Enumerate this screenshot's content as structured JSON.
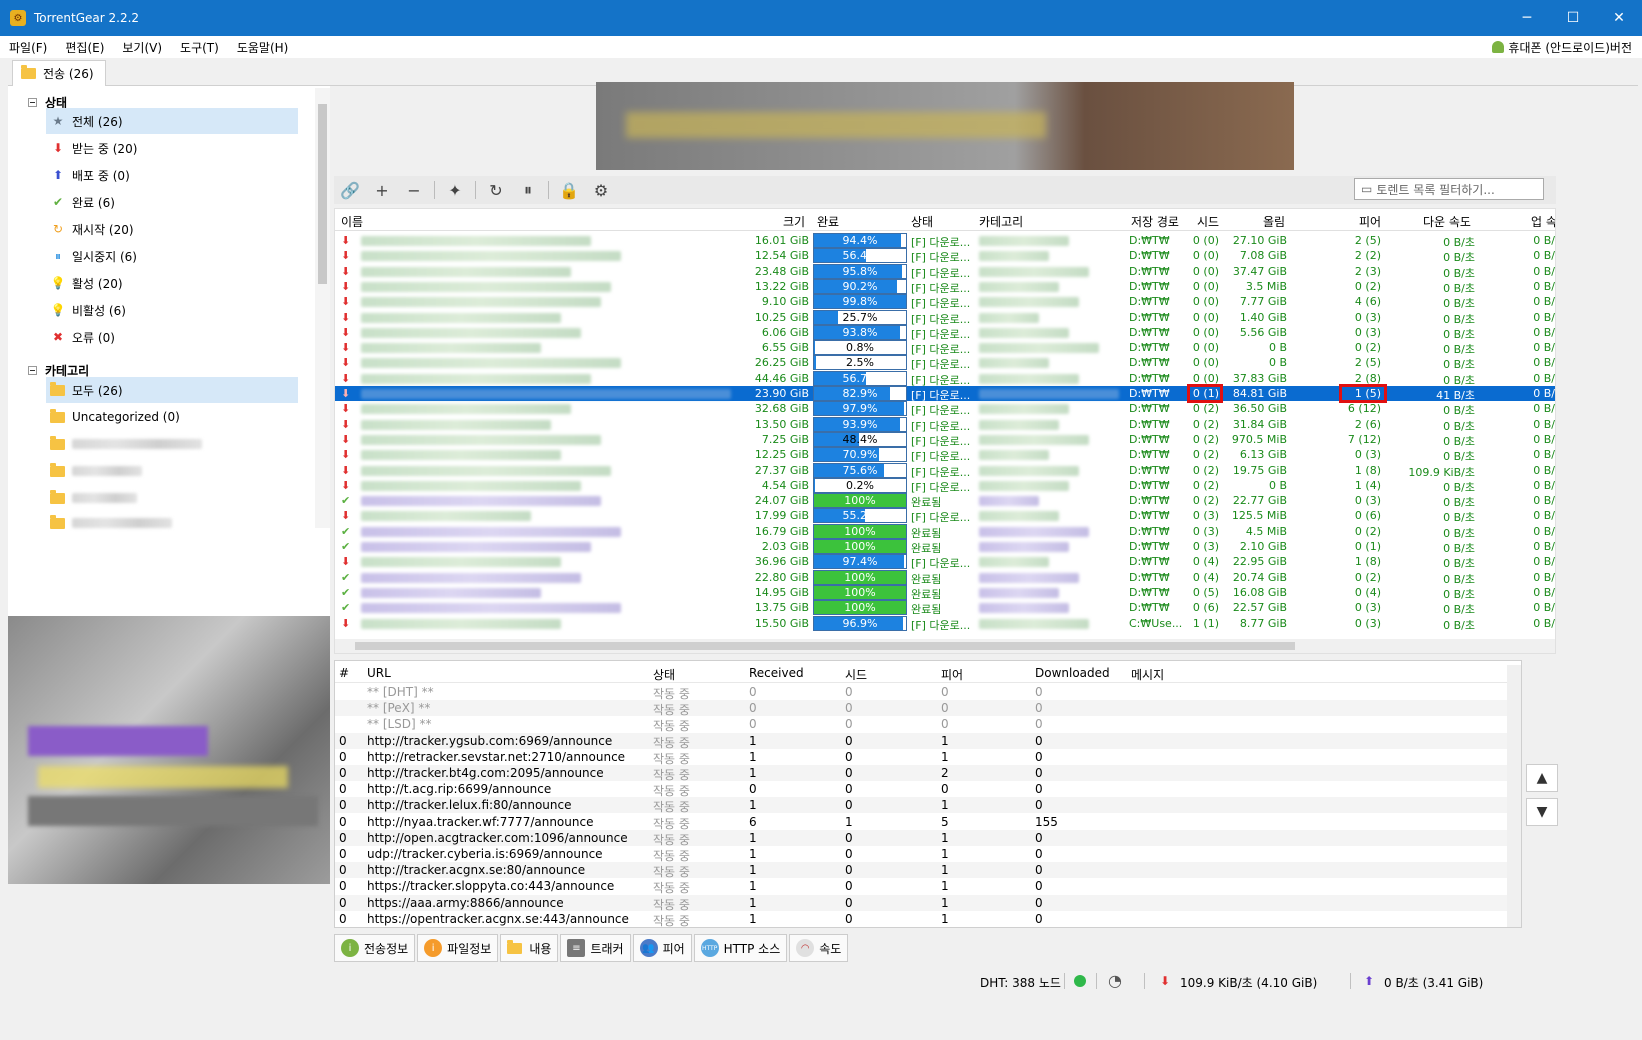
{
  "window": {
    "title": "TorrentGear 2.2.2"
  },
  "menu": {
    "items": [
      "파일(F)",
      "편집(E)",
      "보기(V)",
      "도구(T)",
      "도움말(H)"
    ],
    "mobile": "휴대폰 (안드로이드)버전"
  },
  "tab": {
    "label": "전송 (26)"
  },
  "sidebar": {
    "status_header": "상태",
    "status_items": [
      {
        "label": "전체 (26)",
        "icon": "star-icon"
      },
      {
        "label": "받는 중 (20)",
        "icon": "down-arrow-icon"
      },
      {
        "label": "배포 중 (0)",
        "icon": "up-arrow-icon"
      },
      {
        "label": "완료 (6)",
        "icon": "check-icon"
      },
      {
        "label": "재시작 (20)",
        "icon": "restart-icon"
      },
      {
        "label": "일시중지 (6)",
        "icon": "pause-icon"
      },
      {
        "label": "활성 (20)",
        "icon": "bulb-on-icon"
      },
      {
        "label": "비활성 (6)",
        "icon": "bulb-off-icon"
      },
      {
        "label": "오류 (0)",
        "icon": "error-icon"
      }
    ],
    "category_header": "카테고리",
    "category_items": [
      {
        "label": "모두 (26)"
      },
      {
        "label": "Uncategorized (0)"
      }
    ]
  },
  "toolbar": {
    "filter_placeholder": "토렌트 목록 필터하기..."
  },
  "grid": {
    "headers": {
      "name": "이름",
      "size": "크기",
      "done": "완료",
      "state": "상태",
      "category": "카테고리",
      "path": "저장 경로",
      "seeds": "시드",
      "upload": "올림",
      "peers": "피어",
      "down_speed": "다운 속도",
      "up_speed": "업 속"
    },
    "rows": [
      {
        "size": "16.01 GiB",
        "pct": 94.4,
        "pct_label": "94.4%",
        "state": "[F] 다운로...",
        "path": "D:₩T₩",
        "seeds": "0 (0)",
        "up": "27.10 GiB",
        "peers": "2 (5)",
        "dspeed": "0 B/초",
        "uspeed": "0 B/"
      },
      {
        "size": "12.54 GiB",
        "pct": 56.4,
        "pct_label": "56.4%",
        "state": "[F] 다운로...",
        "path": "D:₩T₩",
        "seeds": "0 (0)",
        "up": "7.08 GiB",
        "peers": "2 (2)",
        "dspeed": "0 B/초",
        "uspeed": "0 B/"
      },
      {
        "size": "23.48 GiB",
        "pct": 95.8,
        "pct_label": "95.8%",
        "state": "[F] 다운로...",
        "path": "D:₩T₩",
        "seeds": "0 (0)",
        "up": "37.47 GiB",
        "peers": "2 (3)",
        "dspeed": "0 B/초",
        "uspeed": "0 B/"
      },
      {
        "size": "13.22 GiB",
        "pct": 90.2,
        "pct_label": "90.2%",
        "state": "[F] 다운로...",
        "path": "D:₩T₩",
        "seeds": "0 (0)",
        "up": "3.5 MiB",
        "peers": "0 (2)",
        "dspeed": "0 B/초",
        "uspeed": "0 B/"
      },
      {
        "size": "9.10 GiB",
        "pct": 99.8,
        "pct_label": "99.8%",
        "state": "[F] 다운로...",
        "path": "D:₩T₩",
        "seeds": "0 (0)",
        "up": "7.77 GiB",
        "peers": "4 (6)",
        "dspeed": "0 B/초",
        "uspeed": "0 B/"
      },
      {
        "size": "10.25 GiB",
        "pct": 25.7,
        "pct_label": "25.7%",
        "state": "[F] 다운로...",
        "path": "D:₩T₩",
        "seeds": "0 (0)",
        "up": "1.40 GiB",
        "peers": "0 (3)",
        "dspeed": "0 B/초",
        "uspeed": "0 B/"
      },
      {
        "size": "6.06 GiB",
        "pct": 93.8,
        "pct_label": "93.8%",
        "state": "[F] 다운로...",
        "path": "D:₩T₩",
        "seeds": "0 (0)",
        "up": "5.56 GiB",
        "peers": "0 (3)",
        "dspeed": "0 B/초",
        "uspeed": "0 B/"
      },
      {
        "size": "6.55 GiB",
        "pct": 0.8,
        "pct_label": "0.8%",
        "state": "[F] 다운로...",
        "path": "D:₩T₩",
        "seeds": "0 (0)",
        "up": "0 B",
        "peers": "0 (2)",
        "dspeed": "0 B/초",
        "uspeed": "0 B/"
      },
      {
        "size": "26.25 GiB",
        "pct": 2.5,
        "pct_label": "2.5%",
        "state": "[F] 다운로...",
        "path": "D:₩T₩",
        "seeds": "0 (0)",
        "up": "0 B",
        "peers": "2 (5)",
        "dspeed": "0 B/초",
        "uspeed": "0 B/"
      },
      {
        "size": "44.46 GiB",
        "pct": 56.7,
        "pct_label": "56.7%",
        "state": "[F] 다운로...",
        "path": "D:₩T₩",
        "seeds": "0 (0)",
        "up": "37.83 GiB",
        "peers": "2 (8)",
        "dspeed": "0 B/초",
        "uspeed": "0 B/"
      },
      {
        "size": "23.90 GiB",
        "pct": 82.9,
        "pct_label": "82.9%",
        "state": "[F] 다운로...",
        "path": "D:₩T₩",
        "seeds": "0 (1)",
        "up": "84.81 GiB",
        "peers": "1 (5)",
        "dspeed": "41 B/초",
        "uspeed": "0 B/",
        "selected": true
      },
      {
        "size": "32.68 GiB",
        "pct": 97.9,
        "pct_label": "97.9%",
        "state": "[F] 다운로...",
        "path": "D:₩T₩",
        "seeds": "0 (2)",
        "up": "36.50 GiB",
        "peers": "6 (12)",
        "dspeed": "0 B/초",
        "uspeed": "0 B/"
      },
      {
        "size": "13.50 GiB",
        "pct": 93.9,
        "pct_label": "93.9%",
        "state": "[F] 다운로...",
        "path": "D:₩T₩",
        "seeds": "0 (2)",
        "up": "31.84 GiB",
        "peers": "2 (6)",
        "dspeed": "0 B/초",
        "uspeed": "0 B/"
      },
      {
        "size": "7.25 GiB",
        "pct": 48.4,
        "pct_label": "48.4%",
        "state": "[F] 다운로...",
        "path": "D:₩T₩",
        "seeds": "0 (2)",
        "up": "970.5 MiB",
        "peers": "7 (12)",
        "dspeed": "0 B/초",
        "uspeed": "0 B/"
      },
      {
        "size": "12.25 GiB",
        "pct": 70.9,
        "pct_label": "70.9%",
        "state": "[F] 다운로...",
        "path": "D:₩T₩",
        "seeds": "0 (2)",
        "up": "6.13 GiB",
        "peers": "0 (3)",
        "dspeed": "0 B/초",
        "uspeed": "0 B/"
      },
      {
        "size": "27.37 GiB",
        "pct": 75.6,
        "pct_label": "75.6%",
        "state": "[F] 다운로...",
        "path": "D:₩T₩",
        "seeds": "0 (2)",
        "up": "19.75 GiB",
        "peers": "1 (8)",
        "dspeed": "109.9 KiB/초",
        "uspeed": "0 B/"
      },
      {
        "size": "4.54 GiB",
        "pct": 0.2,
        "pct_label": "0.2%",
        "state": "[F] 다운로...",
        "path": "D:₩T₩",
        "seeds": "0 (2)",
        "up": "0 B",
        "peers": "1 (4)",
        "dspeed": "0 B/초",
        "uspeed": "0 B/"
      },
      {
        "size": "24.07 GiB",
        "pct": 100,
        "pct_label": "100%",
        "state": "완료됨",
        "path": "D:₩T₩",
        "seeds": "0 (2)",
        "up": "22.77 GiB",
        "peers": "0 (3)",
        "dspeed": "0 B/초",
        "uspeed": "0 B/",
        "done": true
      },
      {
        "size": "17.99 GiB",
        "pct": 55.2,
        "pct_label": "55.2%",
        "state": "[F] 다운로...",
        "path": "D:₩T₩",
        "seeds": "0 (3)",
        "up": "125.5 MiB",
        "peers": "0 (6)",
        "dspeed": "0 B/초",
        "uspeed": "0 B/"
      },
      {
        "size": "16.79 GiB",
        "pct": 100,
        "pct_label": "100%",
        "state": "완료됨",
        "path": "D:₩T₩",
        "seeds": "0 (3)",
        "up": "4.5 MiB",
        "peers": "0 (2)",
        "dspeed": "0 B/초",
        "uspeed": "0 B/",
        "done": true
      },
      {
        "size": "2.03 GiB",
        "pct": 100,
        "pct_label": "100%",
        "state": "완료됨",
        "path": "D:₩T₩",
        "seeds": "0 (3)",
        "up": "2.10 GiB",
        "peers": "0 (1)",
        "dspeed": "0 B/초",
        "uspeed": "0 B/",
        "done": true
      },
      {
        "size": "36.96 GiB",
        "pct": 97.4,
        "pct_label": "97.4%",
        "state": "[F] 다운로...",
        "path": "D:₩T₩",
        "seeds": "0 (4)",
        "up": "22.95 GiB",
        "peers": "1 (8)",
        "dspeed": "0 B/초",
        "uspeed": "0 B/"
      },
      {
        "size": "22.80 GiB",
        "pct": 100,
        "pct_label": "100%",
        "state": "완료됨",
        "path": "D:₩T₩",
        "seeds": "0 (4)",
        "up": "20.74 GiB",
        "peers": "0 (2)",
        "dspeed": "0 B/초",
        "uspeed": "0 B/",
        "done": true
      },
      {
        "size": "14.95 GiB",
        "pct": 100,
        "pct_label": "100%",
        "state": "완료됨",
        "path": "D:₩T₩",
        "seeds": "0 (5)",
        "up": "16.08 GiB",
        "peers": "0 (4)",
        "dspeed": "0 B/초",
        "uspeed": "0 B/",
        "done": true
      },
      {
        "size": "13.75 GiB",
        "pct": 100,
        "pct_label": "100%",
        "state": "완료됨",
        "path": "D:₩T₩",
        "seeds": "0 (6)",
        "up": "22.57 GiB",
        "peers": "0 (3)",
        "dspeed": "0 B/초",
        "uspeed": "0 B/",
        "done": true
      },
      {
        "size": "15.50 GiB",
        "pct": 96.9,
        "pct_label": "96.9%",
        "state": "[F] 다운로...",
        "path": "C:₩Use...",
        "seeds": "1 (1)",
        "up": "8.77 GiB",
        "peers": "0 (3)",
        "dspeed": "0 B/초",
        "uspeed": "0 B/"
      }
    ]
  },
  "trackers": {
    "headers": {
      "num": "#",
      "url": "URL",
      "state": "상태",
      "received": "Received",
      "seeds": "시드",
      "peers": "피어",
      "downloaded": "Downloaded",
      "message": "메시지"
    },
    "rows": [
      {
        "num": "",
        "url": "** [DHT] **",
        "state": "작동 중",
        "recv": "0",
        "seeds": "0",
        "peers": "0",
        "dl": "0",
        "grey": true
      },
      {
        "num": "",
        "url": "** [PeX] **",
        "state": "작동 중",
        "recv": "0",
        "seeds": "0",
        "peers": "0",
        "dl": "0",
        "grey": true
      },
      {
        "num": "",
        "url": "** [LSD] **",
        "state": "작동 중",
        "recv": "0",
        "seeds": "0",
        "peers": "0",
        "dl": "0",
        "grey": true
      },
      {
        "num": "0",
        "url": "http://tracker.ygsub.com:6969/announce",
        "state": "작동 중",
        "recv": "1",
        "seeds": "0",
        "peers": "1",
        "dl": "0"
      },
      {
        "num": "0",
        "url": "http://retracker.sevstar.net:2710/announce",
        "state": "작동 중",
        "recv": "1",
        "seeds": "0",
        "peers": "1",
        "dl": "0"
      },
      {
        "num": "0",
        "url": "http://tracker.bt4g.com:2095/announce",
        "state": "작동 중",
        "recv": "1",
        "seeds": "0",
        "peers": "2",
        "dl": "0"
      },
      {
        "num": "0",
        "url": "http://t.acg.rip:6699/announce",
        "state": "작동 중",
        "recv": "0",
        "seeds": "0",
        "peers": "0",
        "dl": "0"
      },
      {
        "num": "0",
        "url": "http://tracker.lelux.fi:80/announce",
        "state": "작동 중",
        "recv": "1",
        "seeds": "0",
        "peers": "1",
        "dl": "0"
      },
      {
        "num": "0",
        "url": "http://nyaa.tracker.wf:7777/announce",
        "state": "작동 중",
        "recv": "6",
        "seeds": "1",
        "peers": "5",
        "dl": "155"
      },
      {
        "num": "0",
        "url": "http://open.acgtracker.com:1096/announce",
        "state": "작동 중",
        "recv": "1",
        "seeds": "0",
        "peers": "1",
        "dl": "0"
      },
      {
        "num": "0",
        "url": "udp://tracker.cyberia.is:6969/announce",
        "state": "작동 중",
        "recv": "1",
        "seeds": "0",
        "peers": "1",
        "dl": "0"
      },
      {
        "num": "0",
        "url": "http://tracker.acgnx.se:80/announce",
        "state": "작동 중",
        "recv": "1",
        "seeds": "0",
        "peers": "1",
        "dl": "0"
      },
      {
        "num": "0",
        "url": "https://tracker.sloppyta.co:443/announce",
        "state": "작동 중",
        "recv": "1",
        "seeds": "0",
        "peers": "1",
        "dl": "0"
      },
      {
        "num": "0",
        "url": "https://aaa.army:8866/announce",
        "state": "작동 중",
        "recv": "1",
        "seeds": "0",
        "peers": "1",
        "dl": "0"
      },
      {
        "num": "0",
        "url": "https://opentracker.acgnx.se:443/announce",
        "state": "작동 중",
        "recv": "1",
        "seeds": "0",
        "peers": "1",
        "dl": "0"
      }
    ]
  },
  "bottom_tabs": [
    "전송정보",
    "파일정보",
    "내용",
    "트래커",
    "피어",
    "HTTP 소스",
    "속도"
  ],
  "status": {
    "dht": "DHT: 388 노드",
    "down": "109.9 KiB/초 (4.10 GiB)",
    "up": "0 B/초 (3.41 GiB)"
  },
  "colors": {
    "accent": "#1473c8",
    "progress": "#1d82e0",
    "complete": "#3cc23c",
    "text_green": "#1a8a1a",
    "highlight": "#e01010"
  }
}
